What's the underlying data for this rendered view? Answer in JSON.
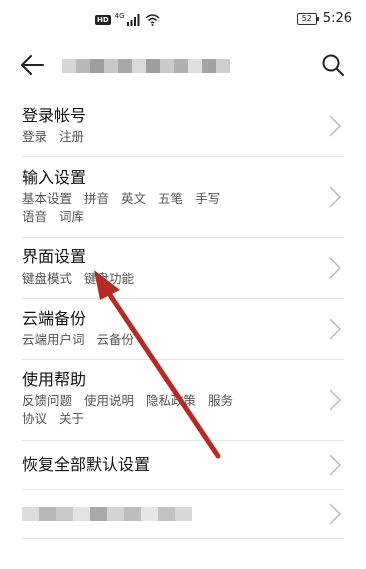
{
  "status_bar": {
    "hd": "HD",
    "net": "4G",
    "battery": "52",
    "time": "5:26"
  },
  "header": {
    "title": "",
    "back_icon": "back-arrow-icon",
    "search_icon": "search-icon"
  },
  "settings": [
    {
      "title": "登录帐号",
      "subs": [
        "登录",
        "注册"
      ]
    },
    {
      "title": "输入设置",
      "subs": [
        "基本设置",
        "拼音",
        "英文",
        "五笔",
        "手写",
        "语音",
        "词库"
      ]
    },
    {
      "title": "界面设置",
      "subs": [
        "键盘模式",
        "键盘功能"
      ]
    },
    {
      "title": "云端备份",
      "subs": [
        "云端用户词",
        "云备份"
      ]
    },
    {
      "title": "使用帮助",
      "subs": [
        "反馈问题",
        "使用说明",
        "隐私政策",
        "服务",
        "协议",
        "关于"
      ]
    },
    {
      "title": "恢复全部默认设置",
      "subs": []
    },
    {
      "title": "",
      "subs": []
    }
  ],
  "colors": {
    "annotation_arrow": "#b52a24",
    "divider": "#e4e4e4",
    "pixelate_light": "#d2d2d2",
    "pixelate_dark": "#9a9a9a"
  }
}
